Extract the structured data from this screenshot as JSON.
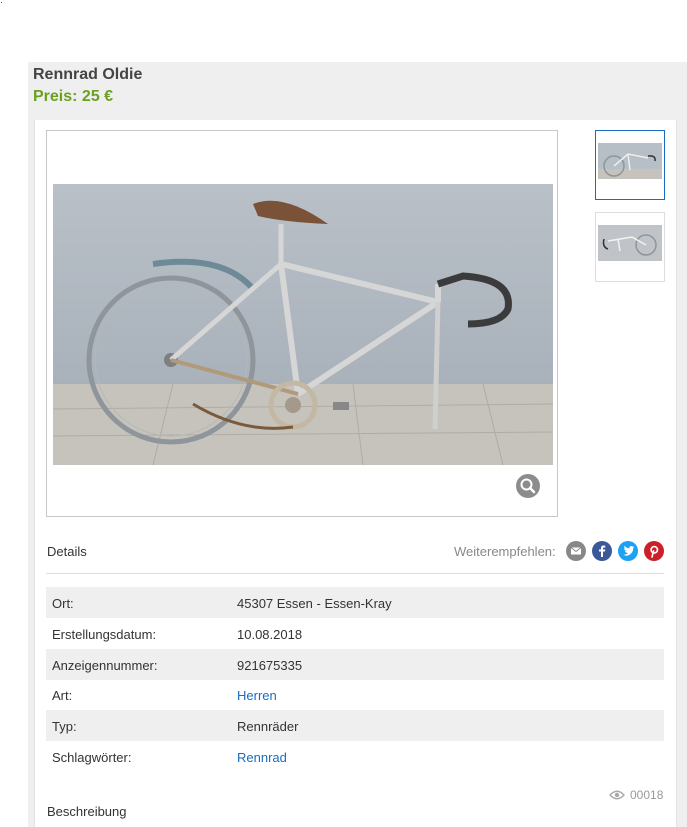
{
  "listing": {
    "title": "Rennrad Oldie",
    "price": "Preis: 25 €"
  },
  "gallery": {
    "thumbnails": [
      "thumbnail-1",
      "thumbnail-2"
    ],
    "zoom_icon": "magnifier-icon"
  },
  "details": {
    "heading": "Details",
    "share_label": "Weiterempfehlen:",
    "share_icons": [
      "email-icon",
      "facebook-icon",
      "twitter-icon",
      "pinterest-icon"
    ],
    "rows": [
      {
        "key": "Ort:",
        "value": "45307 Essen - Essen-Kray"
      },
      {
        "key": "Erstellungsdatum:",
        "value": "10.08.2018"
      },
      {
        "key": "Anzeigennummer:",
        "value": "921675335"
      },
      {
        "key": "Art:",
        "value": "Herren"
      },
      {
        "key": "Typ:",
        "value": "Rennräder"
      },
      {
        "key": "Schlagwörter:",
        "value": "Rennrad"
      }
    ]
  },
  "stats": {
    "views": "00018",
    "views_icon": "eye-icon"
  },
  "description": {
    "heading": "Beschreibung"
  },
  "colors": {
    "price": "#6aa121",
    "link": "#1a6dbd",
    "email": "#888888",
    "facebook": "#3b5998",
    "twitter": "#1da1f2",
    "pinterest": "#cb2027"
  }
}
